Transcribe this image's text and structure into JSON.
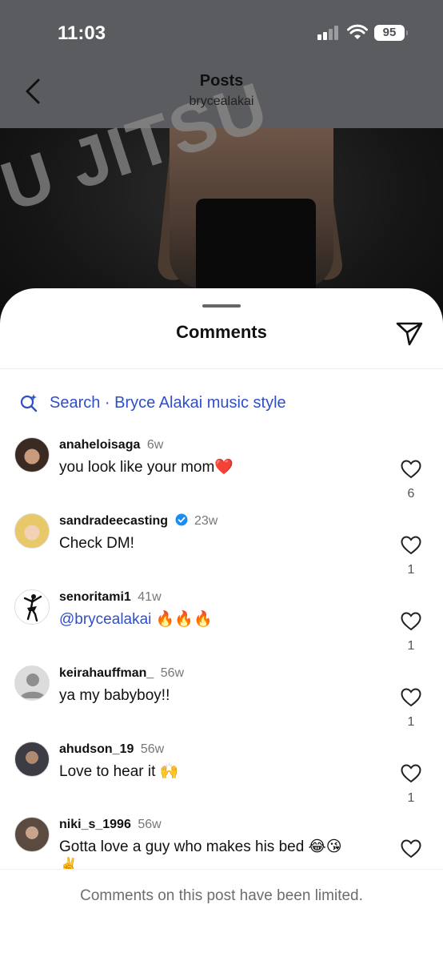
{
  "status_bar": {
    "time": "11:03",
    "battery": "95"
  },
  "header": {
    "title": "Posts",
    "subtitle": "brycealakai"
  },
  "background_text": "U JITSU",
  "sheet": {
    "title": "Comments",
    "search_text": "Search · Bryce Alakai music style"
  },
  "comments": [
    {
      "username": "anaheloisaga",
      "age": "6w",
      "text": "you look like your mom❤️",
      "likes": "6"
    },
    {
      "username": "sandradeecasting",
      "verified": true,
      "age": "23w",
      "text": "Check DM!",
      "likes": "1"
    },
    {
      "username": "senoritami1",
      "age": "41w",
      "mention": "@brycealakai",
      "text": "🔥🔥🔥",
      "likes": "1"
    },
    {
      "username": "keirahauffman_",
      "age": "56w",
      "text": "ya my babyboy!!",
      "likes": "1"
    },
    {
      "username": "ahudson_19",
      "age": "56w",
      "text": "Love to hear it 🙌",
      "likes": "1"
    },
    {
      "username": "niki_s_1996",
      "age": "56w",
      "text": "Gotta love a guy who makes his bed 😂😘",
      "text_overflow": "✌️"
    }
  ],
  "footer": {
    "text": "Comments on this post have been limited."
  },
  "colors": {
    "link": "#2f4fc7",
    "header_bg": "#5a5c5f"
  }
}
